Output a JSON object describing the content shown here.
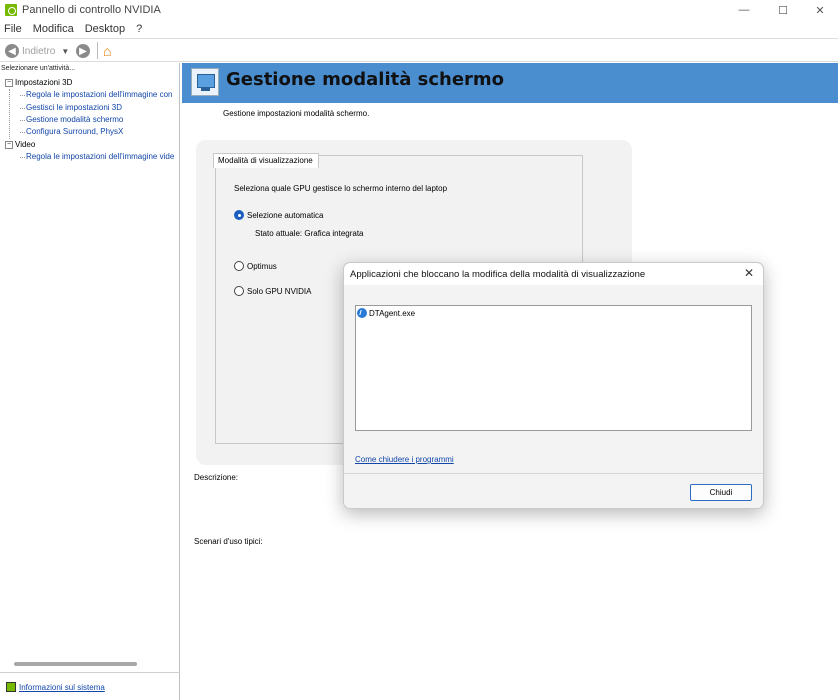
{
  "window": {
    "title": "Pannello di controllo NVIDIA",
    "minimize_glyph": "—",
    "maximize_glyph": "☐",
    "close_glyph": "✕"
  },
  "menu": [
    "File",
    "Modifica",
    "Desktop",
    "?"
  ],
  "toolbar": {
    "back_label": "Indietro",
    "back_icon": "back-arrow-icon",
    "forward_icon": "forward-arrow-icon",
    "home_icon": "home-icon"
  },
  "sidebar": {
    "header": "Selezionare un'attività...",
    "categories": [
      {
        "label": "Impostazioni 3D",
        "expander": "⊟",
        "items": [
          "Regola le impostazioni dell'immagine con",
          "Gestisci le impostazioni 3D",
          "Gestione modalità schermo",
          "Configura Surround, PhysX"
        ]
      },
      {
        "label": "Video",
        "expander": "⊟",
        "items": [
          "Regola le impostazioni dell'immagine vide"
        ]
      }
    ],
    "system_info_link": "Informazioni sul sistema"
  },
  "main": {
    "title": "Gestione modalità schermo",
    "subtitle": "Gestione impostazioni modalità schermo.",
    "tab_label": "Modalità di visualizzazione",
    "question": "Seleziona quale GPU gestisce lo schermo interno del laptop",
    "options": [
      {
        "label": "Selezione automatica",
        "selected": true
      },
      {
        "label": "Optimus",
        "selected": false
      },
      {
        "label": "Solo GPU NVIDIA",
        "selected": false
      }
    ],
    "current_state": "Stato attuale: Grafica integrata",
    "description_label": "Descrizione:",
    "scenarios_label": "Scenari d'uso tipici:"
  },
  "dialog": {
    "title": "Applicazioni che bloccano la modifica della modalità di visualizzazione",
    "close_glyph": "✕",
    "apps": [
      "DTAgent.exe"
    ],
    "help_link": "Come chiudere i programmi",
    "close_button": "Chiudi"
  },
  "colors": {
    "banner": "#4a8ed0",
    "nvidia_green": "#76b900",
    "link": "#1246a8",
    "accent": "#1a5fbf"
  }
}
